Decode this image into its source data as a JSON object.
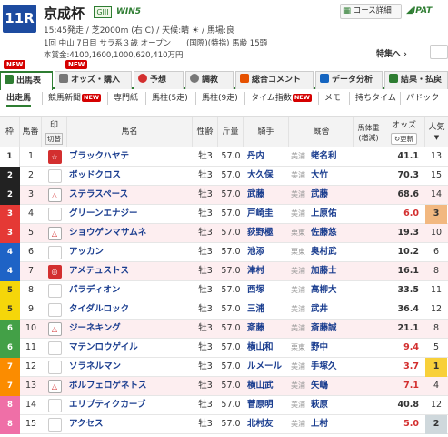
{
  "race": {
    "number": "11R",
    "name": "京成杯",
    "grade": "GIII",
    "win5": "WIN5",
    "info_line": "15:45発走 / 芝2000m (右 C) / 天候:晴 ☀ / 馬場:良",
    "detail_line": "1回 中山 7日目 サラ系３歳 オープン　　(国際)(特指) 馬齢 15頭",
    "prize_line": "本賞金:4100,1600,1000,620,410万円"
  },
  "header": {
    "course_button": "コース詳細",
    "ipat": "IPAT",
    "tokusen": "特集へ"
  },
  "badges": {
    "new": "NEW"
  },
  "tabs": [
    {
      "label": "出馬表",
      "icon": "table-icon",
      "color": "#2e7d32"
    },
    {
      "label": "オッズ・購入",
      "icon": "odds-icon",
      "color": "#555"
    },
    {
      "label": "予想",
      "icon": "target-icon",
      "color": "#d32f2f"
    },
    {
      "label": "調教",
      "icon": "stopwatch-icon",
      "color": "#555"
    },
    {
      "label": "総合コメント",
      "icon": "comment-icon",
      "color": "#e65100"
    },
    {
      "label": "データ分析",
      "icon": "chart-icon",
      "color": "#1565c0"
    },
    {
      "label": "結果・払戻",
      "icon": "result-icon",
      "color": "#2e7d32"
    }
  ],
  "subtabs": [
    "出走馬",
    "競馬新聞",
    "NEW",
    "専門紙",
    "馬柱(5走)",
    "馬柱(9走)",
    "タイム指数",
    "NEW",
    "メモ",
    "持ちタイム",
    "パドック"
  ],
  "columns": {
    "waku": "枠",
    "uma": "馬番",
    "mark": "印",
    "mark_sub": "切替",
    "name": "馬名",
    "sex_age": "性齢",
    "weight": "斤量",
    "jockey": "騎手",
    "trainer": "厩舎",
    "body_weight": "馬体重(増減)",
    "odds": "オッズ",
    "odds_update": "更新",
    "pop": "人気"
  },
  "horses": [
    {
      "waku": "1",
      "uma": "1",
      "mark": "☆",
      "name": "ブラックハヤテ",
      "sex": "牡3",
      "kin": "57.0",
      "jockey": "丹内",
      "reg": "美浦",
      "trainer": "蛯名利",
      "odds": "41.1",
      "pop": "13",
      "waku_color": "#ffffff",
      "waku_text": "#333",
      "hl": false,
      "red_odds": false
    },
    {
      "waku": "2",
      "uma": "2",
      "mark": "",
      "name": "ボッドクロス",
      "sex": "牡3",
      "kin": "57.0",
      "jockey": "大久保",
      "reg": "美浦",
      "trainer": "大竹",
      "odds": "70.3",
      "pop": "15",
      "waku_color": "#222222",
      "waku_text": "#fff",
      "hl": false,
      "red_odds": false
    },
    {
      "waku": "2",
      "uma": "3",
      "mark": "△",
      "name": "ステラスペース",
      "sex": "牡3",
      "kin": "57.0",
      "jockey": "武藤",
      "reg": "美浦",
      "trainer": "武藤",
      "odds": "68.6",
      "pop": "14",
      "waku_color": "#222222",
      "waku_text": "#fff",
      "hl": true,
      "red_odds": false
    },
    {
      "waku": "3",
      "uma": "4",
      "mark": "",
      "name": "グリーンエナジー",
      "sex": "牡3",
      "kin": "57.0",
      "jockey": "戸崎圭",
      "reg": "美浦",
      "trainer": "上原佑",
      "odds": "6.0",
      "pop": "3",
      "waku_color": "#e53935",
      "waku_text": "#fff",
      "hl": false,
      "red_odds": true
    },
    {
      "waku": "3",
      "uma": "5",
      "mark": "△",
      "name": "ショウゲンマサムネ",
      "sex": "牡3",
      "kin": "57.0",
      "jockey": "荻野極",
      "reg": "栗東",
      "trainer": "佐藤悠",
      "odds": "19.3",
      "pop": "10",
      "waku_color": "#e53935",
      "waku_text": "#fff",
      "hl": true,
      "red_odds": false
    },
    {
      "waku": "4",
      "uma": "6",
      "mark": "",
      "name": "アッカン",
      "sex": "牡3",
      "kin": "57.0",
      "jockey": "池添",
      "reg": "栗東",
      "trainer": "奥村武",
      "odds": "10.2",
      "pop": "6",
      "waku_color": "#1e63c6",
      "waku_text": "#fff",
      "hl": false,
      "red_odds": false
    },
    {
      "waku": "4",
      "uma": "7",
      "mark": "◎",
      "name": "アメテュストス",
      "sex": "牡3",
      "kin": "57.0",
      "jockey": "津村",
      "reg": "美浦",
      "trainer": "加藤士",
      "odds": "16.1",
      "pop": "8",
      "waku_color": "#1e63c6",
      "waku_text": "#fff",
      "hl": true,
      "red_odds": false
    },
    {
      "waku": "5",
      "uma": "8",
      "mark": "",
      "name": "パラディオン",
      "sex": "牡3",
      "kin": "57.0",
      "jockey": "西塚",
      "reg": "美浦",
      "trainer": "高柳大",
      "odds": "33.5",
      "pop": "11",
      "waku_color": "#f5d60a",
      "waku_text": "#333",
      "hl": false,
      "red_odds": false
    },
    {
      "waku": "5",
      "uma": "9",
      "mark": "",
      "name": "タイダルロック",
      "sex": "牡3",
      "kin": "57.0",
      "jockey": "三浦",
      "reg": "美浦",
      "trainer": "武井",
      "odds": "36.4",
      "pop": "12",
      "waku_color": "#f5d60a",
      "waku_text": "#333",
      "hl": false,
      "red_odds": false
    },
    {
      "waku": "6",
      "uma": "10",
      "mark": "△",
      "name": "ジーネキング",
      "sex": "牡3",
      "kin": "57.0",
      "jockey": "斎藤",
      "reg": "美浦",
      "trainer": "斎藤誠",
      "odds": "21.1",
      "pop": "8",
      "waku_color": "#43a047",
      "waku_text": "#fff",
      "hl": true,
      "red_odds": false
    },
    {
      "waku": "6",
      "uma": "11",
      "mark": "",
      "name": "マテンロウゲイル",
      "sex": "牡3",
      "kin": "57.0",
      "jockey": "横山和",
      "reg": "栗東",
      "trainer": "野中",
      "odds": "9.4",
      "pop": "5",
      "waku_color": "#43a047",
      "waku_text": "#fff",
      "hl": false,
      "red_odds": true
    },
    {
      "waku": "7",
      "uma": "12",
      "mark": "",
      "name": "ソラネルマン",
      "sex": "牡3",
      "kin": "57.0",
      "jockey": "ルメール",
      "reg": "美浦",
      "trainer": "手塚久",
      "odds": "3.7",
      "pop": "1",
      "waku_color": "#fb8c00",
      "waku_text": "#fff",
      "hl": false,
      "red_odds": true
    },
    {
      "waku": "7",
      "uma": "13",
      "mark": "△",
      "name": "ボルフェロゲネトス",
      "sex": "牡3",
      "kin": "57.0",
      "jockey": "横山武",
      "reg": "美浦",
      "trainer": "矢嶋",
      "odds": "7.1",
      "pop": "4",
      "waku_color": "#fb8c00",
      "waku_text": "#fff",
      "hl": true,
      "red_odds": true
    },
    {
      "waku": "8",
      "uma": "14",
      "mark": "",
      "name": "エリプティクカーブ",
      "sex": "牡3",
      "kin": "57.0",
      "jockey": "菅原明",
      "reg": "美浦",
      "trainer": "萩原",
      "odds": "40.8",
      "pop": "12",
      "waku_color": "#ef6fa7",
      "waku_text": "#fff",
      "hl": false,
      "red_odds": false
    },
    {
      "waku": "8",
      "uma": "15",
      "mark": "",
      "name": "アクセス",
      "sex": "牡3",
      "kin": "57.0",
      "jockey": "北村友",
      "reg": "美浦",
      "trainer": "上村",
      "odds": "5.0",
      "pop": "2",
      "waku_color": "#ef6fa7",
      "waku_text": "#fff",
      "hl": false,
      "red_odds": true
    }
  ]
}
